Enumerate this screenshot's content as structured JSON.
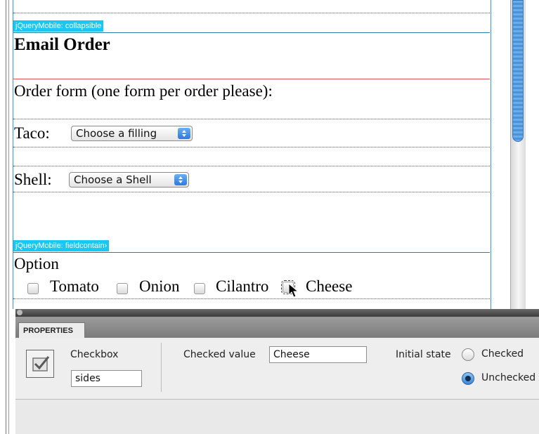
{
  "design_view": {
    "collapsible_tag": "jQueryMobile: collapsible",
    "heading": "Email Order",
    "intro": "Order form (one form per order please):",
    "taco_label": "Taco:",
    "taco_select": "Choose a filling",
    "shell_label": "Shell:",
    "shell_select": "Choose a Shell",
    "fieldcontain_tag": "jQueryMobile: fieldcontain›",
    "option_label": "Option",
    "options": [
      "Tomato",
      "Onion",
      "Cilantro",
      "Cheese"
    ]
  },
  "properties_panel": {
    "tab_label": "PROPERTIES",
    "element_type": "Checkbox",
    "element_name": "sides",
    "checked_value_label": "Checked value",
    "checked_value": "Cheese",
    "initial_state_label": "Initial state",
    "radio_checked_label": "Checked",
    "radio_unchecked_label": "Unchecked",
    "initial_state_selected": "Unchecked"
  },
  "colors": {
    "tag_bg": "#18c8f3",
    "frame_border": "#2ea3c6",
    "scroll_thumb": "#5aa0e2"
  }
}
